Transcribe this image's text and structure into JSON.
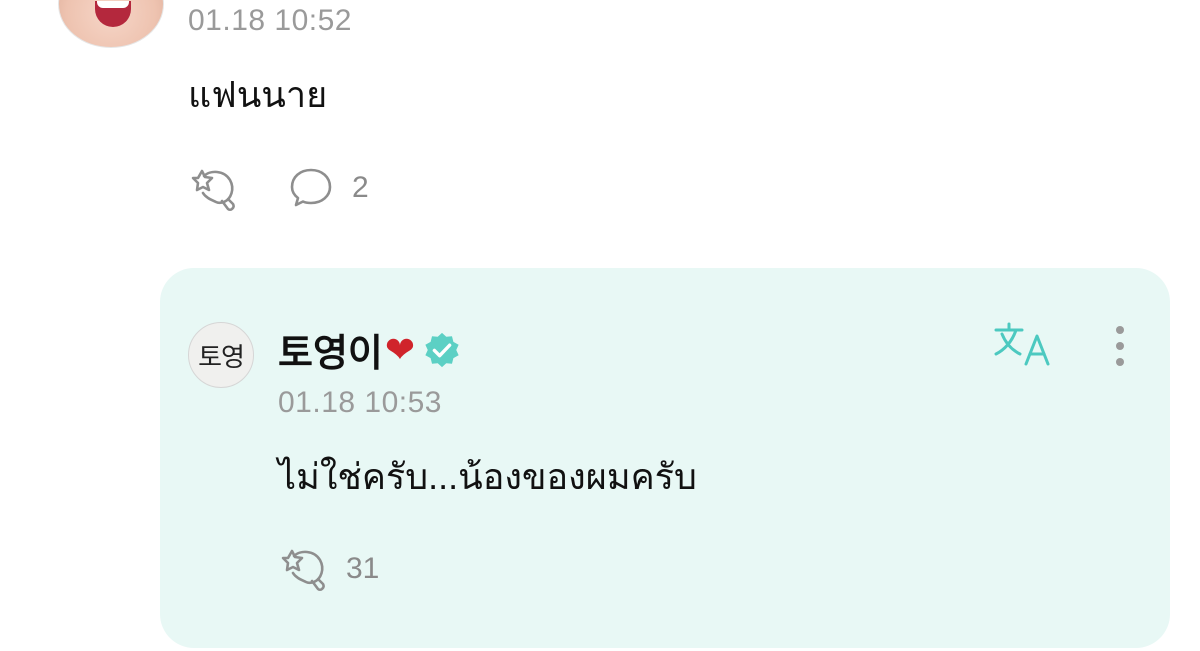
{
  "comment": {
    "timestamp": "01.18 10:52",
    "text": "แฟนนาย",
    "reply_count": "2",
    "icons": {
      "react": "star-cluster-like-icon",
      "reply": "speech-bubble-icon"
    }
  },
  "reply": {
    "avatar_text": "토영",
    "author_name": "토영이",
    "heart": "❤",
    "verified": "verified-badge-icon",
    "timestamp": "01.18 10:53",
    "text": "ไม่ใช่ครับ...น้องของผมครับ",
    "like_count": "31",
    "icons": {
      "translate": "translate-icon",
      "more": "more-vertical-icon",
      "react": "star-cluster-like-icon"
    },
    "colors": {
      "card_bg": "#e8f8f5",
      "accent": "#4cc9c0",
      "heart": "#d0242b"
    }
  }
}
